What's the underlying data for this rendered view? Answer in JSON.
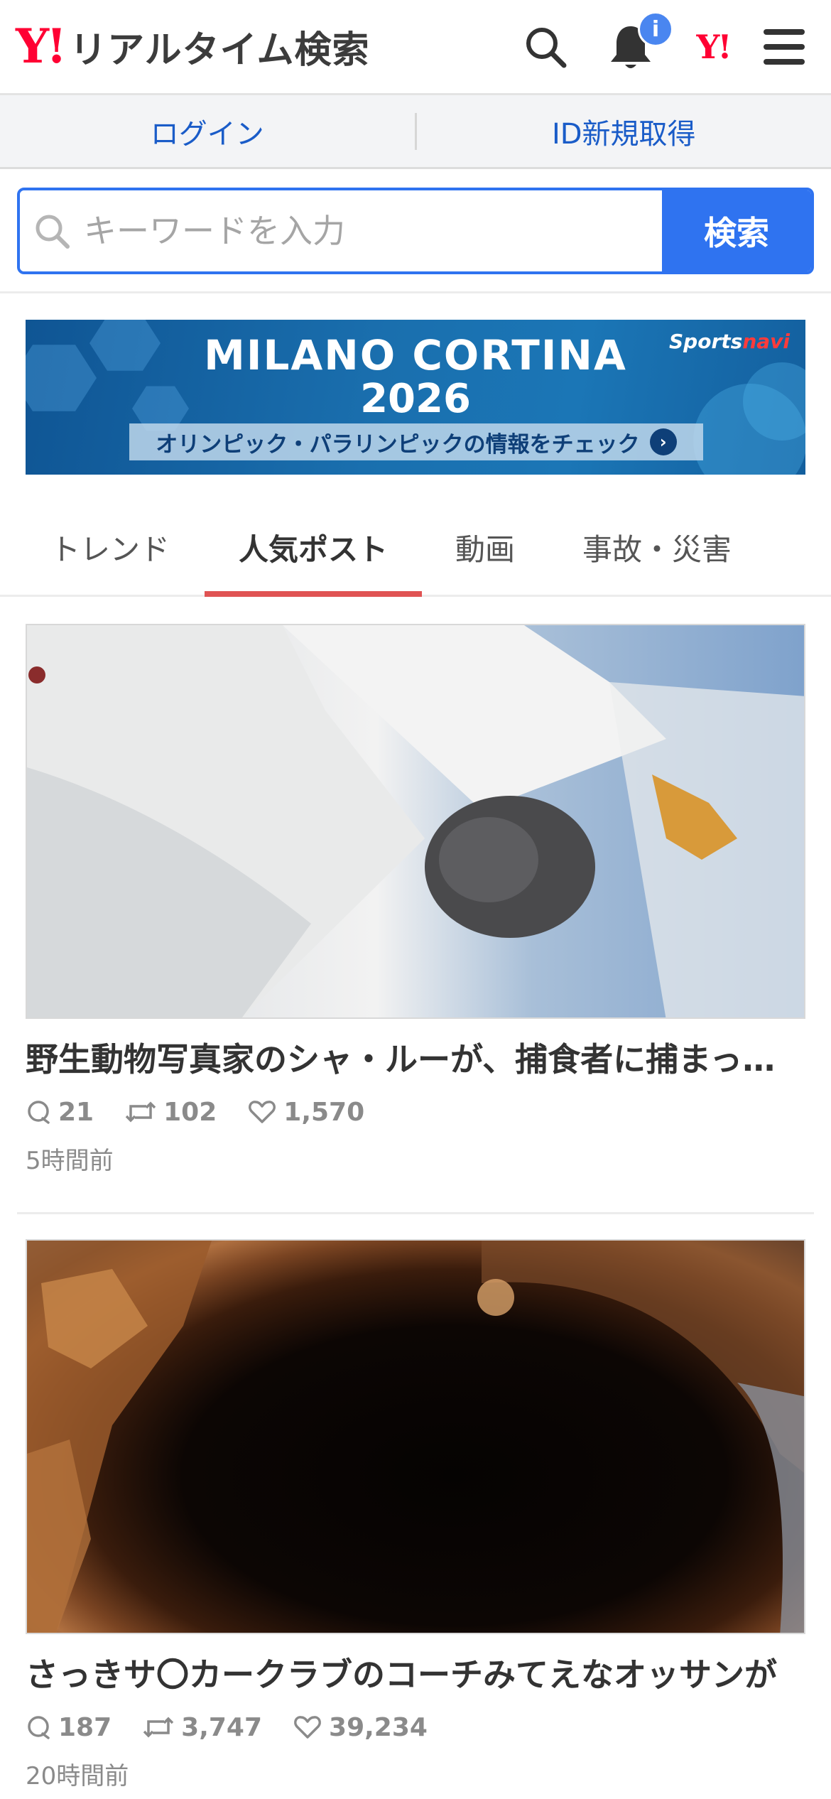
{
  "header": {
    "logo_mark": "Y!",
    "logo_text": "リアルタイム検索",
    "notification_count": "i",
    "yahoo_mark": "Y!"
  },
  "auth": {
    "login_label": "ログイン",
    "signup_label": "ID新規取得"
  },
  "search": {
    "placeholder": "キーワードを入力",
    "value": "",
    "button_label": "検索"
  },
  "banner": {
    "title": "MILANO CORTINA",
    "year": "2026",
    "subtitle": "オリンピック・パラリンピックの情報をチェック",
    "brand_a": "Sports",
    "brand_b": "navi"
  },
  "tabs": [
    {
      "label": "トレンド",
      "active": false
    },
    {
      "label": "人気ポスト",
      "active": true
    },
    {
      "label": "動画",
      "active": false
    },
    {
      "label": "事故・災害",
      "active": false
    }
  ],
  "posts": [
    {
      "title": "野生動物写真家のシャ・ルーが、捕食者に捕まった獲物の瞬間を捉えた写真",
      "replies": "21",
      "reposts": "102",
      "likes": "1,570",
      "time": "5時間前"
    },
    {
      "title": "さっきサ〇カークラブのコーチみてえなオッサンが",
      "replies": "187",
      "reposts": "3,747",
      "likes": "39,234",
      "time": "20時間前"
    }
  ],
  "colors": {
    "brand_red": "#ff0033",
    "accent_blue": "#2f73f0",
    "link_blue": "#1a5cc8",
    "tab_underline": "#e05353"
  }
}
